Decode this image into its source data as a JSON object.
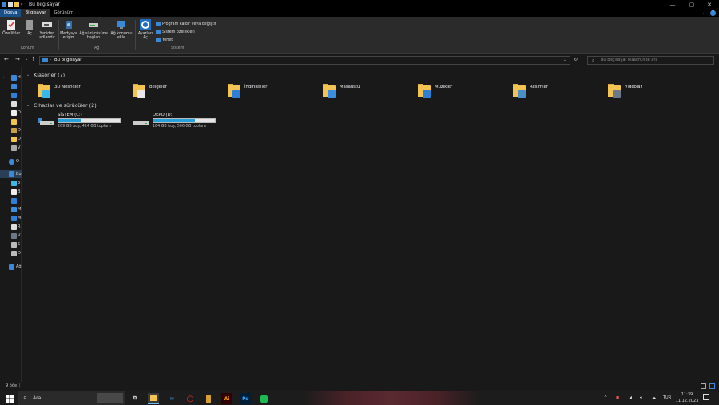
{
  "window": {
    "title": "Bu bilgisayar"
  },
  "ribbon_tabs": [
    "Dosya",
    "Bilgisayar",
    "Görünüm"
  ],
  "ribbon": {
    "location": {
      "label": "Konum",
      "buttons": [
        "Özellikler",
        "Aç",
        "Yeniden adlandır"
      ]
    },
    "network": {
      "label": "Ağ",
      "buttons": [
        "Medyaya erişim",
        "Ağ sürücüsüne bağlan",
        "Ağ konumu ekle"
      ]
    },
    "system": {
      "label": "Sistem",
      "open_settings": "Ayarları Aç",
      "items": [
        "Program kaldır veya değiştir",
        "Sistem özellikleri",
        "Yönet"
      ]
    }
  },
  "address": {
    "path": "Bu bilgisayar",
    "search_placeholder": "Bu bilgisayar klasöründe ara"
  },
  "nav_pane": {
    "groups": [
      {
        "label": "H",
        "items": [
          "I",
          "I",
          "I",
          "D",
          "I",
          "D",
          "D",
          "V"
        ]
      },
      {
        "label": "O",
        "items": []
      },
      {
        "label": "Bu",
        "items": [
          "3",
          "B",
          "İ",
          "M",
          "M",
          "R",
          "V",
          "S",
          "D"
        ]
      },
      {
        "label": "Ağ",
        "items": []
      }
    ]
  },
  "sections": {
    "folders_title": "Klasörler (7)",
    "devices_title": "Cihazlar ve sürücüler (2)"
  },
  "folders": [
    {
      "name": "3D Nesneler",
      "badge": "#3ab8e8"
    },
    {
      "name": "Belgeler",
      "badge": "#e8e8e8"
    },
    {
      "name": "İndirilenler",
      "badge": "#2f7fd8"
    },
    {
      "name": "Masaüstü",
      "badge": "#3a8fe0"
    },
    {
      "name": "Müzikler",
      "badge": "#2f7fd8"
    },
    {
      "name": "Resimler",
      "badge": "#4b8fc8"
    },
    {
      "name": "Videolar",
      "badge": "#6a7a8a"
    }
  ],
  "drives": [
    {
      "name": "SİSTEM (C:)",
      "info": "269 GB boş, 424 GB toplam",
      "used": 0.37
    },
    {
      "name": "DEPO (D:)",
      "info": "164 GB boş, 506 GB toplam",
      "used": 0.68
    }
  ],
  "status": {
    "count": "9 öğe"
  },
  "taskbar": {
    "search": "Ara",
    "lang": "TUR",
    "time": "11:39",
    "date": "11.12.2023"
  },
  "colors": {
    "accent": "#1a4f8a",
    "bar": "#26a0da",
    "folder": "#f4c453"
  }
}
